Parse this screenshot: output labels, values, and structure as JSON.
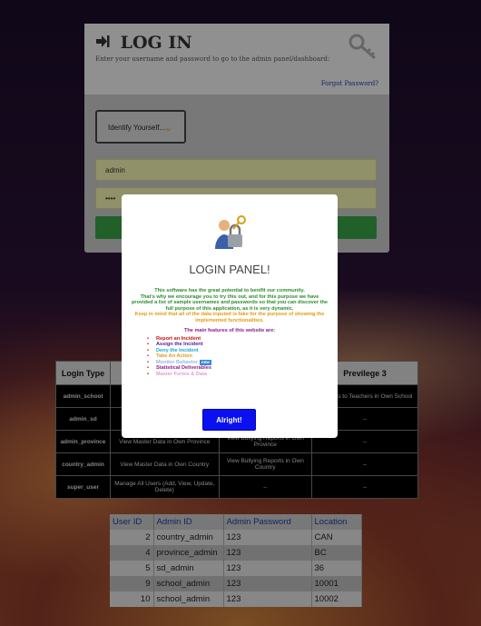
{
  "login": {
    "title": "LOG IN",
    "subtitle": "Enter your username and password to go to the admin panel/dashboard:",
    "forgot": "Forgot Password?",
    "identify_label": "Identify Yourself...",
    "username_value": "admin",
    "password_value": "••••"
  },
  "privilege_table": {
    "headers": [
      "Login Type",
      "",
      "",
      "Previlege 3"
    ],
    "rows": [
      [
        "admin_school",
        "",
        "",
        "Incidents to Teachers in Own School"
      ],
      [
        "admin_sd",
        "",
        "",
        "--"
      ],
      [
        "admin_province",
        "View Master Data in Own Province",
        "View Bullying Reports in Own Province",
        "--"
      ],
      [
        "country_admin",
        "View Master Data in Own Country",
        "View Bullying Reports in Own Country",
        "--"
      ],
      [
        "super_user",
        "Manage All Users (Add, View, Update, Delete)",
        "--",
        "--"
      ]
    ]
  },
  "users_table": {
    "headers": [
      "User ID",
      "Admin ID",
      "Admin Password",
      "Location"
    ],
    "rows": [
      [
        "2",
        "country_admin",
        "123",
        "CAN"
      ],
      [
        "4",
        "province_admin",
        "123",
        "BC"
      ],
      [
        "5",
        "sd_admin",
        "123",
        "36"
      ],
      [
        "9",
        "school_admin",
        "123",
        "10001"
      ],
      [
        "10",
        "school_admin",
        "123",
        "10002"
      ]
    ]
  },
  "modal": {
    "title": "LOGIN PANEL!",
    "intro": "This software has the great potential to benifit our community.",
    "para_green": "That's why we encourage you to try this out, and for this purpose we have provided a list of sample usernames and passwords so that you can discover the full purpose of this application, as it is very dynamic.",
    "para_orange": "Keep in mind that all of the data inputed is fake for the purpose of showing the implemented functionalities.",
    "features_heading": "The main features of this website are:",
    "features": [
      {
        "label": "Report an Incident",
        "color": "#cc1111"
      },
      {
        "label": "Assign the Incident",
        "color": "#4b1e9a"
      },
      {
        "label": "Deny the Incident",
        "color": "#1ba6d8"
      },
      {
        "label": "Take An Action",
        "color": "#e69a0f"
      },
      {
        "label": "Monitor Behavior",
        "color": "#8fb8e0",
        "badge": "new"
      },
      {
        "label": "Statistical Deliverables",
        "color": "#8a1e8a"
      },
      {
        "label": "Master Forms & Data",
        "color": "#e0a0c8"
      }
    ],
    "button": "Alright!"
  }
}
